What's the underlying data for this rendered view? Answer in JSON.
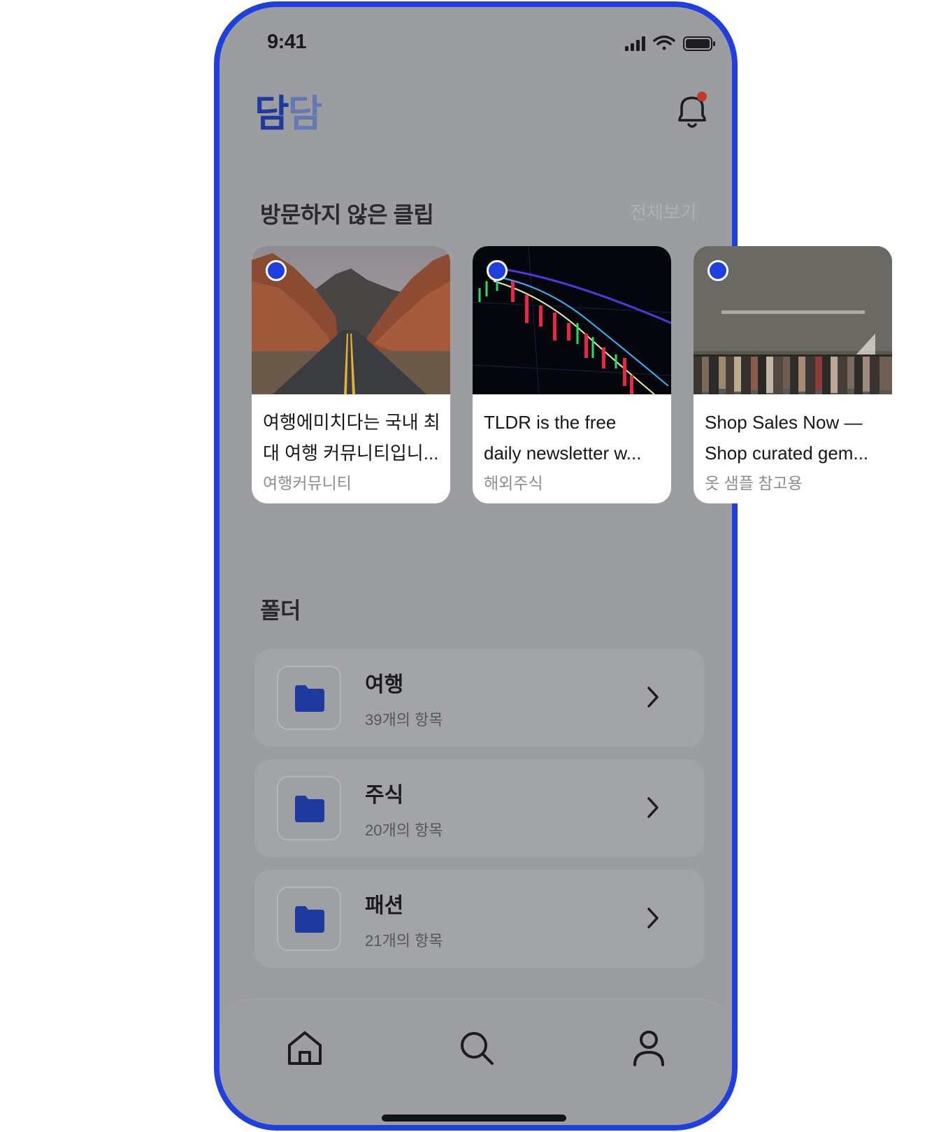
{
  "status_bar": {
    "time": "9:41"
  },
  "header": {
    "logo_part1": "담",
    "logo_part2": "담",
    "has_notification": true
  },
  "unvisited_clips": {
    "title": "방문하지 않은 클립",
    "see_all_label": "전체보기",
    "cards": [
      {
        "title_line1": "여행에미치다는 국내 최",
        "title_line2": "대 여행 커뮤니티입니...",
        "folder": "여행커뮤니티",
        "unread": true
      },
      {
        "title_line1": "TLDR is the free",
        "title_line2": "daily newsletter w...",
        "folder": "해외주식",
        "unread": true
      },
      {
        "title_line1": "Shop Sales Now —",
        "title_line2": "Shop curated gem...",
        "folder": "옷 샘플 참고용",
        "unread": true
      }
    ]
  },
  "folders": {
    "title": "폴더",
    "items": [
      {
        "name": "여행",
        "count": "39개의 항목"
      },
      {
        "name": "주식",
        "count": "20개의 항목"
      },
      {
        "name": "패션",
        "count": "21개의 항목"
      }
    ]
  },
  "tab_bar": {
    "tabs": [
      "home-icon",
      "search-icon",
      "profile-icon"
    ]
  },
  "colors": {
    "accent": "#1f3fe0",
    "logo_dark": "#1e3a9e",
    "logo_light": "#6478b2",
    "overlay": "#9c9da1",
    "notification_dot": "#c0392b"
  }
}
